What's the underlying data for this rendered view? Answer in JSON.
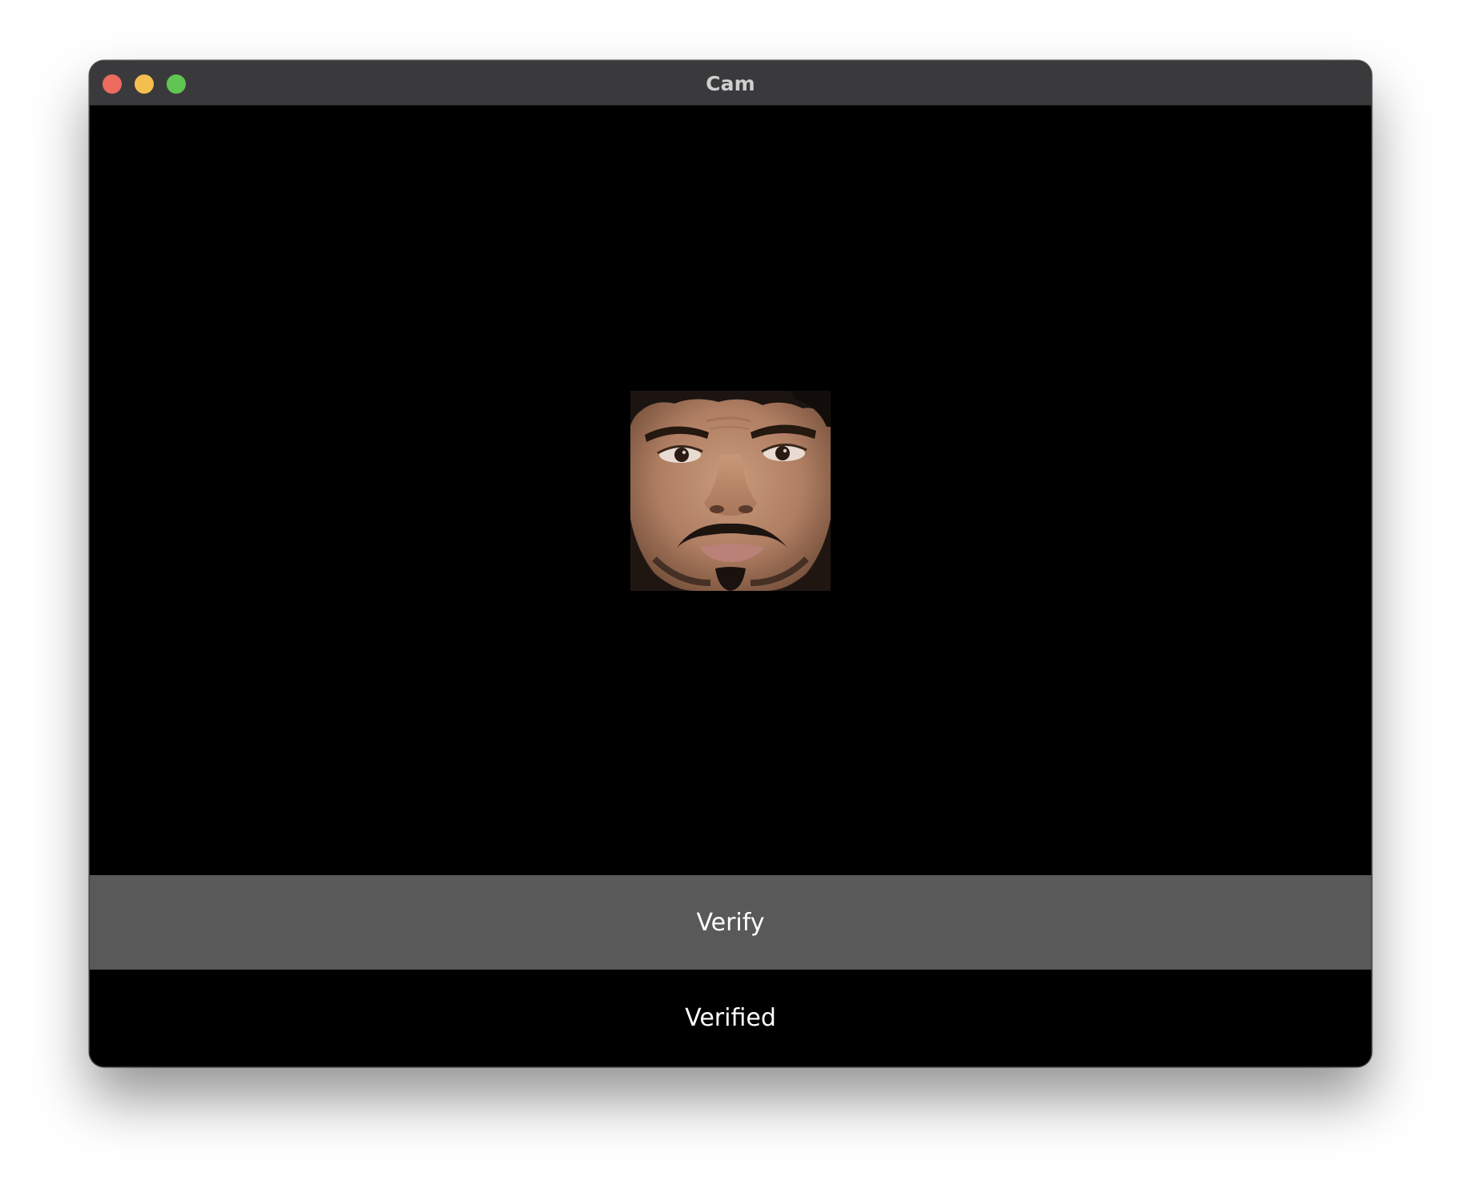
{
  "window": {
    "title": "Cam",
    "controls": {
      "close_color": "#ed6a5e",
      "minimize_color": "#f5bf4f",
      "zoom_color": "#61c554"
    }
  },
  "camera": {
    "background_color": "#000000",
    "frame_content": "detected-face-crop"
  },
  "actions": {
    "verify_label": "Verify",
    "verify_color": "#595959"
  },
  "status": {
    "text": "Verified"
  }
}
